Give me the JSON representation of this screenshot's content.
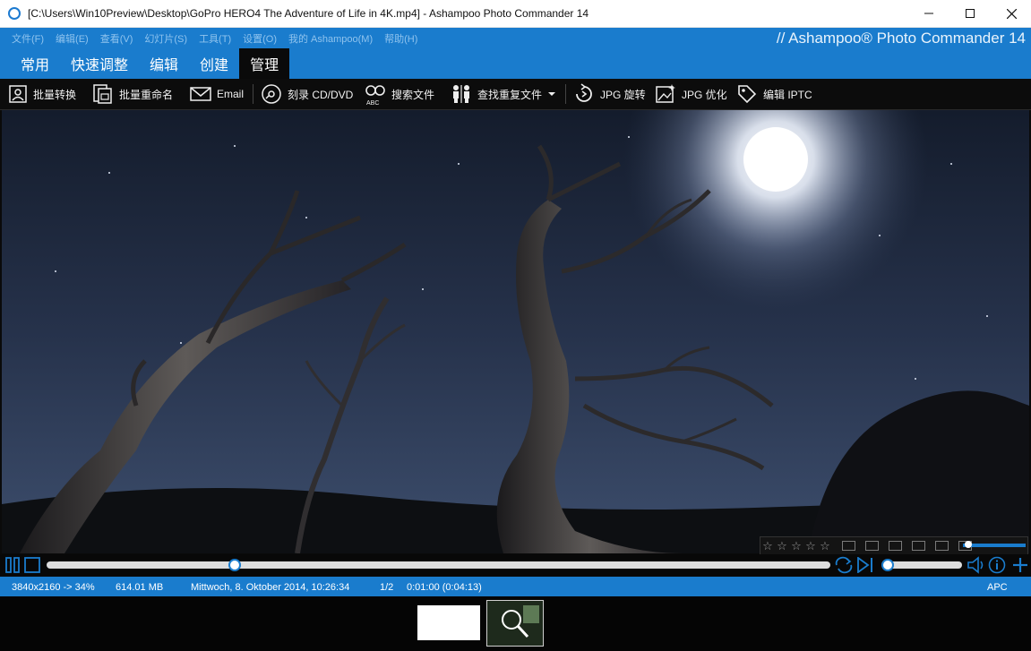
{
  "window": {
    "title": "[C:\\Users\\Win10Preview\\Desktop\\GoPro HERO4  The Adventure of Life in 4K.mp4] - Ashampoo Photo Commander 14",
    "app_icon": "app-ring-icon"
  },
  "menubar": {
    "items": [
      "文件(F)",
      "编辑(E)",
      "查看(V)",
      "幻灯片(S)",
      "工具(T)",
      "设置(O)",
      "我的 Ashampoo(M)",
      "帮助(H)"
    ]
  },
  "brand": "// Ashampoo® Photo Commander 14",
  "tabs": [
    {
      "label": "常用",
      "active": false
    },
    {
      "label": "快速调整",
      "active": false
    },
    {
      "label": "编辑",
      "active": false
    },
    {
      "label": "创建",
      "active": false
    },
    {
      "label": "管理",
      "active": true
    }
  ],
  "toolbar": {
    "batch_convert": "批量转换",
    "batch_rename": "批量重命名",
    "email": "Email",
    "burn": "刻录 CD/DVD",
    "search": "搜索文件",
    "find_duplicates": "查找重复文件",
    "jpg_rotate": "JPG 旋转",
    "jpg_optimize": "JPG 优化",
    "edit_iptc": "编辑 IPTC"
  },
  "playback": {
    "progress": 0.24,
    "volume": 0.0
  },
  "status": {
    "resolution": "3840x2160 -> 34%",
    "filesize": "614.01 MB",
    "date": "Mittwoch, 8. Oktober 2014, 10:26:34",
    "index": "1/2",
    "time": "0:01:00 (0:04:13)",
    "apc": "APC"
  },
  "colors": {
    "accent": "#1a7ccd",
    "toolbar_bg": "#0c0c0c",
    "sky": "#2e3a55"
  }
}
